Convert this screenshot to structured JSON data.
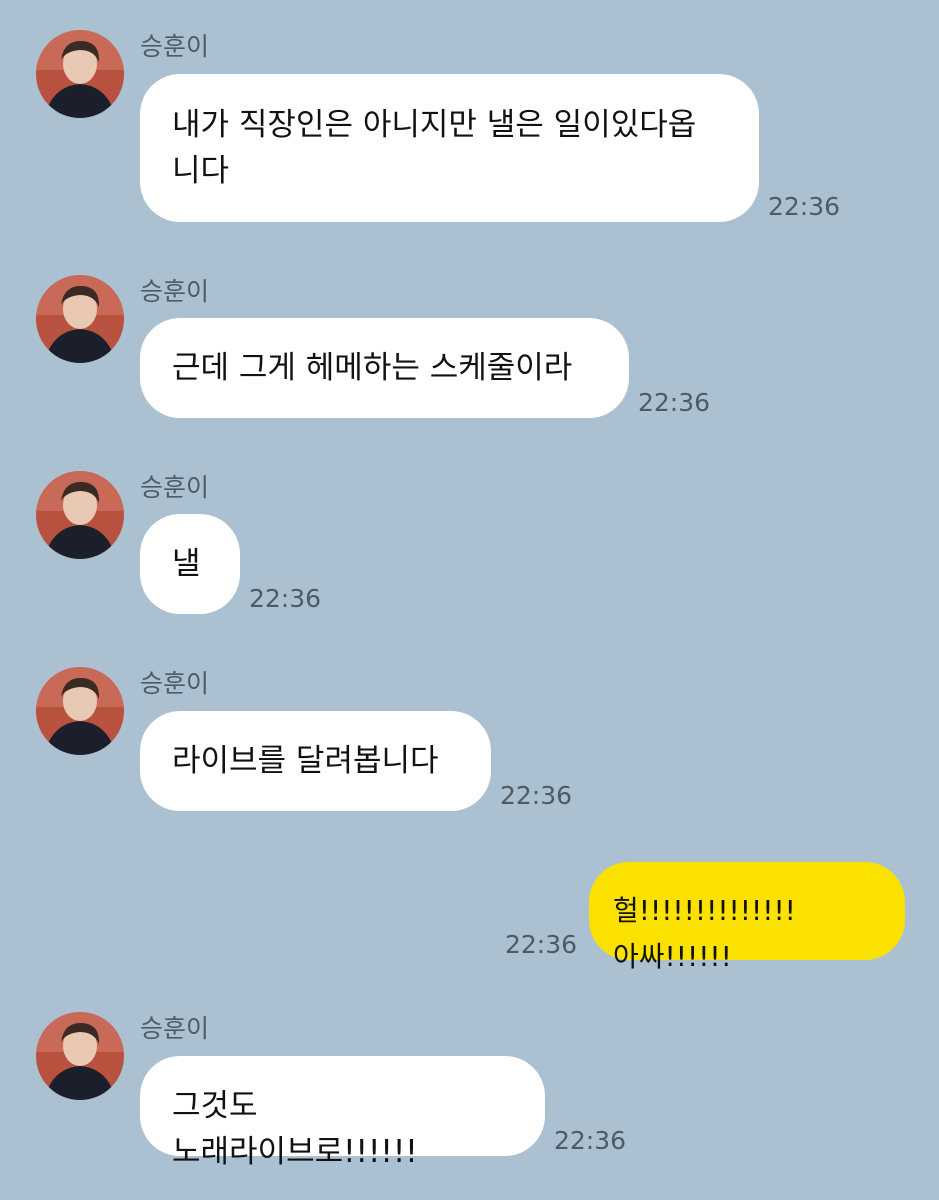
{
  "chat": {
    "messages": [
      {
        "sender": "승훈이",
        "text": "내가 직장인은 아니지만 낼은 일이있다옵\n니다",
        "time": "22:36"
      },
      {
        "sender": "승훈이",
        "text": "근데 그게 헤메하는 스케줄이라",
        "time": "22:36"
      },
      {
        "sender": "승훈이",
        "text": "낼",
        "time": "22:36"
      },
      {
        "sender": "승훈이",
        "text": "라이브를 달려봅니다",
        "time": "22:36"
      },
      {
        "sender": "me",
        "text": "헐!!!!!!!!!!!!!!아싸!!!!!!",
        "time": "22:36"
      },
      {
        "sender": "승훈이",
        "text": "그것도 노래라이브로!!!!!!",
        "time": "22:36"
      }
    ]
  },
  "colors": {
    "background": "#abc1d1",
    "incoming_bubble": "#ffffff",
    "outgoing_bubble": "#fae100"
  },
  "icons": {
    "avatar": "profile-photo"
  }
}
